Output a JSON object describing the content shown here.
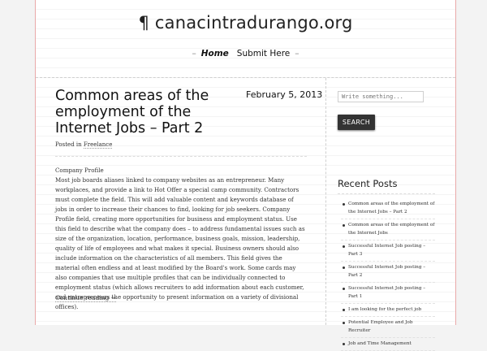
{
  "site": {
    "title": "¶ canacintradurango.org"
  },
  "nav": {
    "dash_left": "–",
    "home": "Home",
    "submit": "Submit Here",
    "dash_right": "–"
  },
  "post": {
    "title": "Common areas of the employment of the Internet Jobs – Part 2",
    "date": "February 5, 2013",
    "posted_in_label": "Posted in",
    "category": "Freelance",
    "section_heading": "Company Profile",
    "body": "Most job boards aliases linked to company websites as an entrepreneur. Many workplaces, and provide a link to Hot Offer a special camp community. Contractors must complete the field. This will add valuable content and keywords database of jobs in order to increase their chances to find, looking for job seekers. Company Profile field, creating more opportunities for business and employment status. Use this field to describe what the company does – to address fundamental issues such as size of the organization, location, performance, business goals, mission, leadership, quality of life of employees and what makes it special. Business owners should also include information on the characteristics of all members. This field gives the material often endless and at least modified by the Board's work. Some cards may also companies that use multiple profiles that can be individually connected to employment status (which allows recruiters to add information about each customer, and entrepreneurs the opportunity to present information on a variety of divisional offices).",
    "continue_reading": "Continue reading →"
  },
  "sidebar": {
    "search_placeholder": "Write something...",
    "search_button": "SEARCH",
    "recent_title": "Recent Posts",
    "recent_posts": [
      "Common areas of the employment of the Internet Jobs – Part 2",
      "Common areas of the employment of the Internet Jobs",
      "Successful Internet Job posting – Part 3",
      "Successful Internet Job posting – Part 2",
      "Successful Internet Job posting – Part 1",
      "I am looking for the perfect job",
      "Potential Employee and Job Recruiter",
      "Job and Time Management"
    ]
  }
}
